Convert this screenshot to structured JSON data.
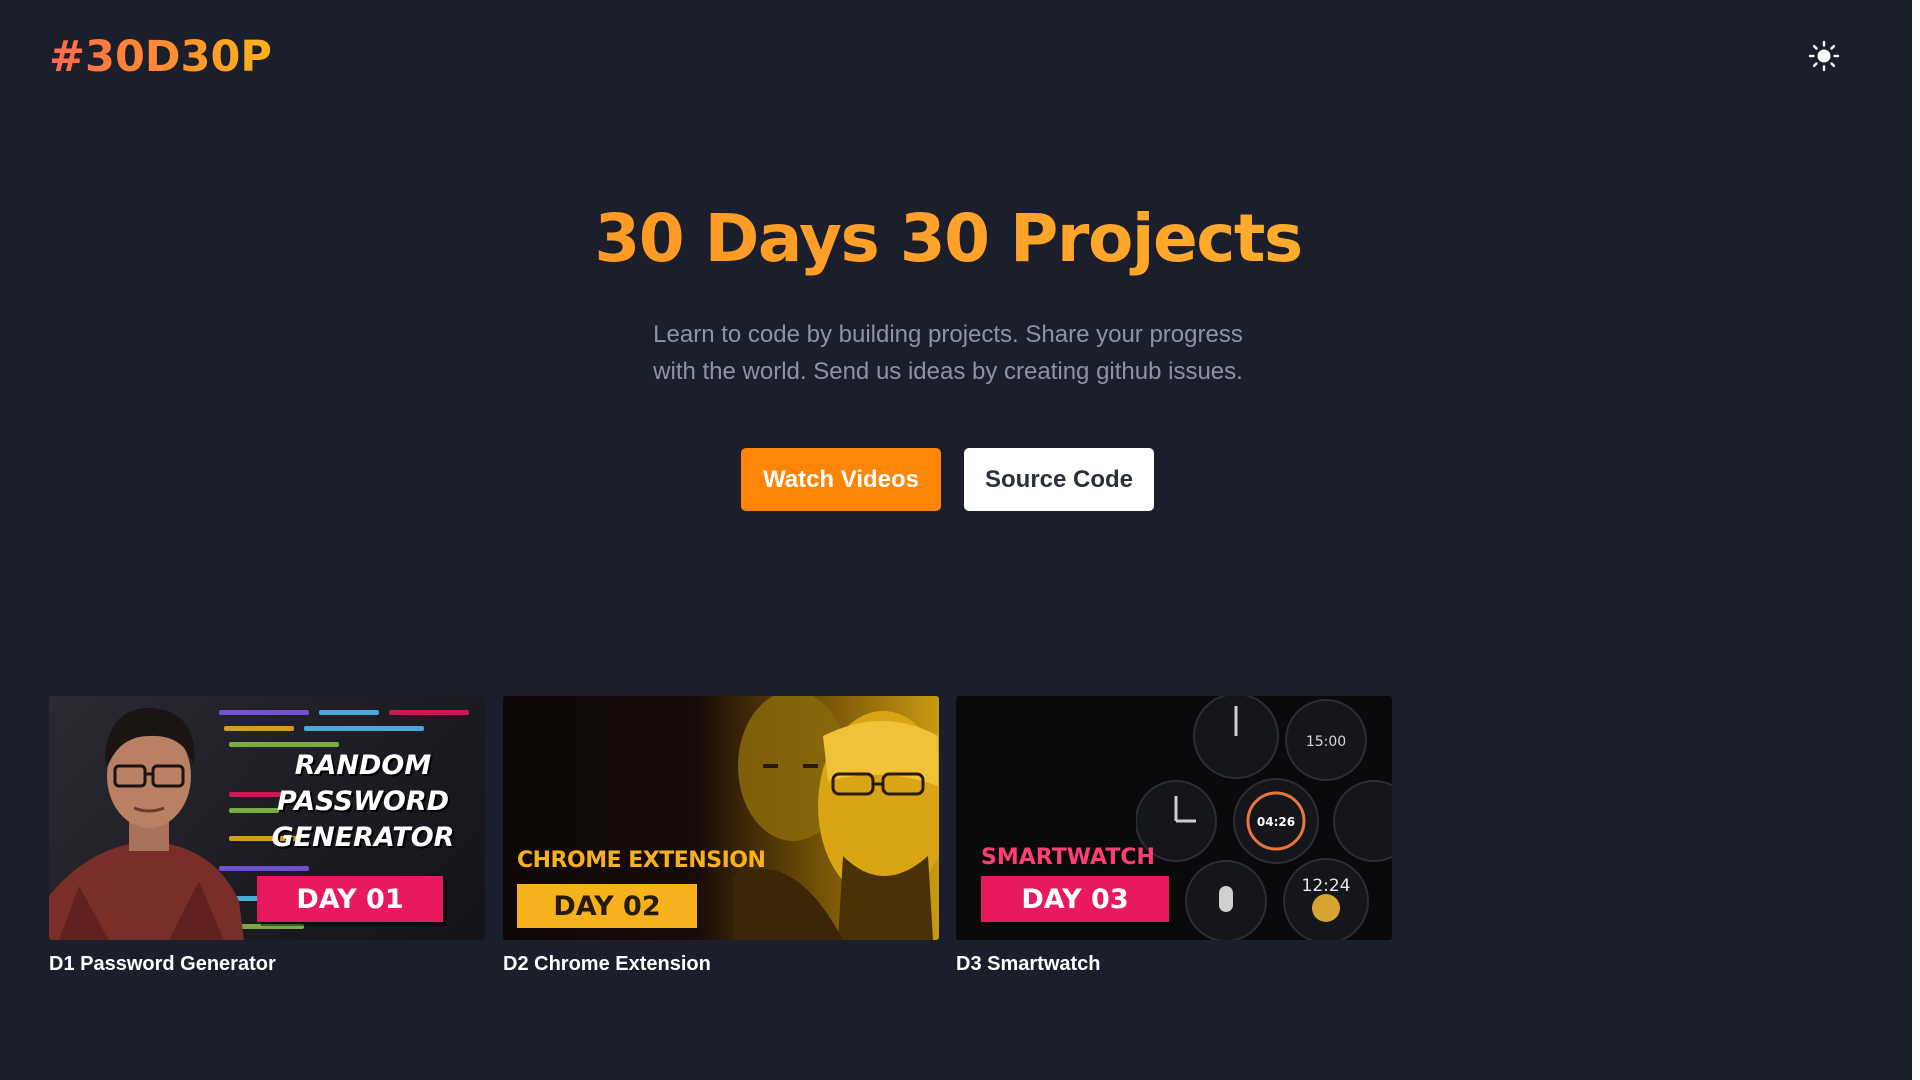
{
  "header": {
    "logo": "#30D30P",
    "theme_toggle_icon": "sun-icon"
  },
  "hero": {
    "title": "30 Days 30 Projects",
    "subtitle_line1": "Learn to code by building projects. Share your progress",
    "subtitle_line2": "with the world. Send us ideas by creating github issues.",
    "primary_button": "Watch Videos",
    "secondary_button": "Source Code"
  },
  "projects": [
    {
      "caption": "D1 Password Generator",
      "thumb_title_line1": "RANDOM",
      "thumb_title_line2": "PASSWORD",
      "thumb_title_line3": "GENERATOR",
      "day_badge": "DAY 01"
    },
    {
      "caption": "D2 Chrome Extension",
      "thumb_label": "CHROME EXTENSION",
      "day_badge": "DAY 02"
    },
    {
      "caption": "D3 Smartwatch",
      "thumb_label": "SMARTWATCH",
      "day_badge": "DAY 03",
      "watch_time_1": "15:00",
      "watch_time_2": "04:26",
      "watch_time_3": "12:24"
    }
  ],
  "colors": {
    "background": "#1b1f2c",
    "accent_orange": "#ff8505",
    "title_gradient_start": "#ff8c1a",
    "title_gradient_end": "#ffbd2e",
    "subtitle": "#8b94a6",
    "badge_pink": "#e8195e"
  }
}
